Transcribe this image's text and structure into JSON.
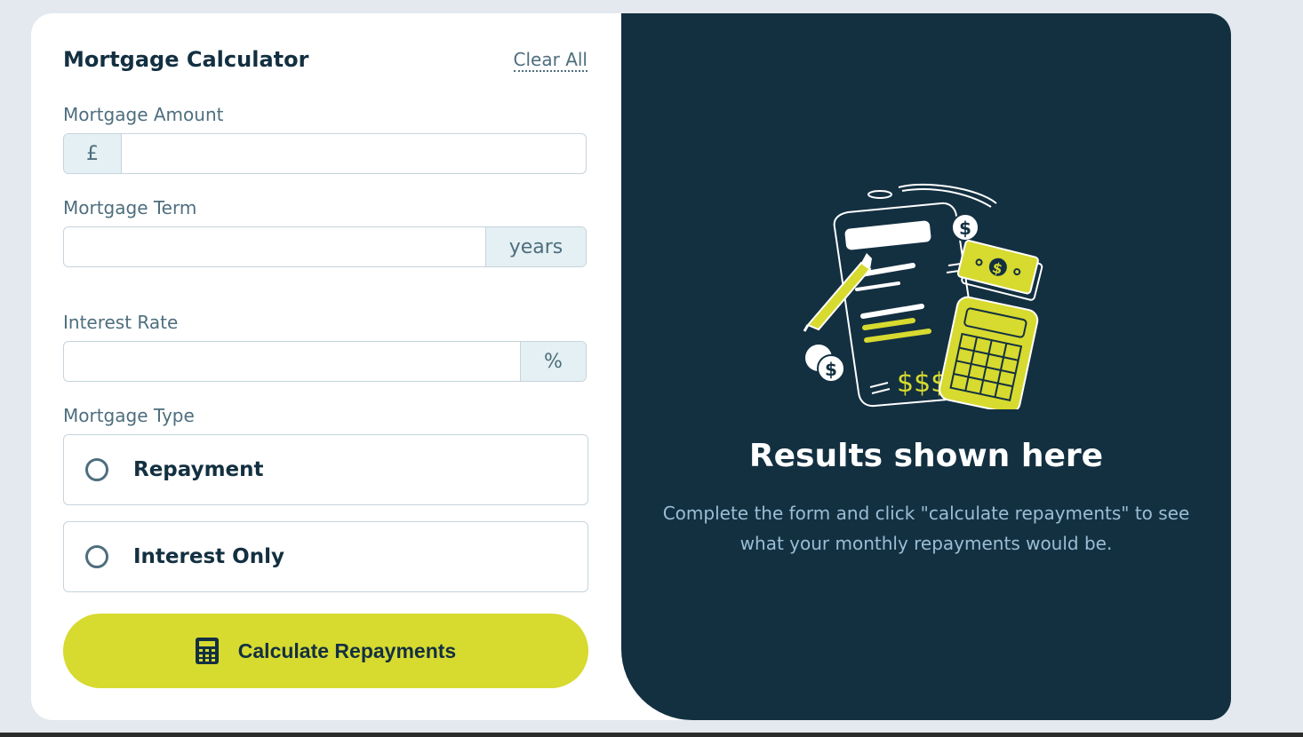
{
  "form": {
    "title": "Mortgage Calculator",
    "clear_all": "Clear All",
    "amount": {
      "label": "Mortgage Amount",
      "prefix": "£",
      "value": ""
    },
    "term": {
      "label": "Mortgage Term",
      "suffix": "years",
      "value": ""
    },
    "rate": {
      "label": "Interest Rate",
      "suffix": "%",
      "value": ""
    },
    "type": {
      "label": "Mortgage Type",
      "options": [
        {
          "label": "Repayment",
          "selected": false
        },
        {
          "label": "Interest Only",
          "selected": false
        }
      ]
    },
    "submit_label": "Calculate Repayments"
  },
  "results": {
    "title": "Results shown here",
    "description": "Complete the form and click \"calculate repayments\" to see what your monthly repayments would be."
  },
  "colors": {
    "accent": "#d7da2f",
    "dark_panel": "#133041",
    "text_primary": "#133041",
    "text_secondary": "#4e6e7e"
  },
  "icons": {
    "submit": "calculator-icon",
    "illustration": "empty-results-illustration"
  }
}
